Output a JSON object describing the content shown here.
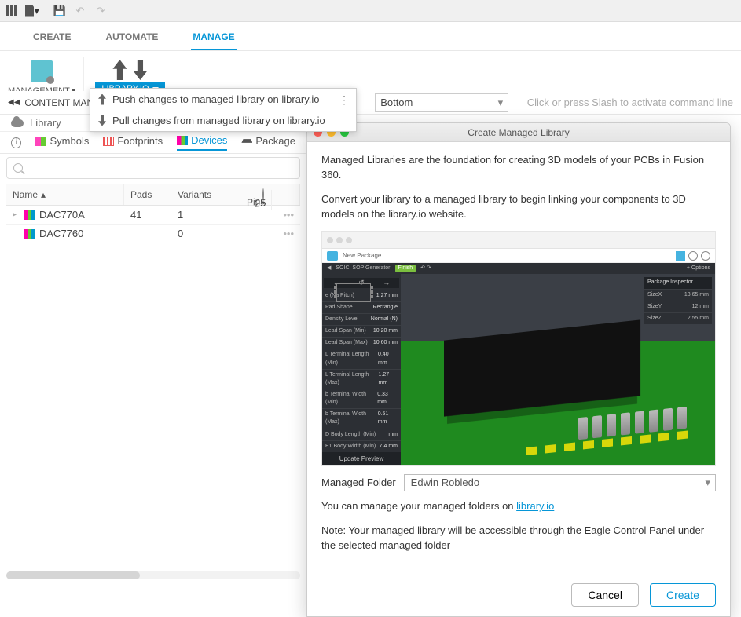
{
  "ribbon": {
    "tabs": {
      "create": "CREATE",
      "automate": "AUTOMATE",
      "manage": "MANAGE"
    },
    "management_label": "MANAGEMENT",
    "libraryio_label": "LIBRARY.IO"
  },
  "libio_menu": {
    "push": "Push changes to managed library on library.io",
    "pull": "Pull changes from managed library on library.io"
  },
  "secbar": {
    "content_manager": "CONTENT MANA",
    "layer_value": "Bottom",
    "command_placeholder": "Click or press Slash to activate command line"
  },
  "library_label": "Library",
  "subtabs": {
    "symbols": "Symbols",
    "footprints": "Footprints",
    "devices": "Devices",
    "packages": "Package"
  },
  "table": {
    "headers": {
      "name": "Name",
      "pins": "Pins",
      "pads": "Pads",
      "variants": "Variants"
    },
    "rows": [
      {
        "name": "DAC770A",
        "pins": "25",
        "pads": "41",
        "variants": "1"
      },
      {
        "name": "DAC7760",
        "pins": "",
        "pads": "",
        "variants": "0"
      }
    ]
  },
  "dialog": {
    "title": "Create Managed Library",
    "p1": "Managed Libraries are the foundation for creating 3D models of your PCBs in Fusion 360.",
    "p2": "Convert your library to a managed library to begin linking your components to 3D models on the library.io website.",
    "preview": {
      "new_package": "New Package",
      "finish": "Finish",
      "soic": "SOIC, SOP Generator",
      "options": "+ Options",
      "inspector_title": "Package Inspector",
      "inspector_rows": [
        {
          "k": "SizeX",
          "v": "13.65",
          "u": "mm"
        },
        {
          "k": "SizeY",
          "v": "12",
          "u": "mm"
        },
        {
          "k": "SizeZ",
          "v": "2.55",
          "u": "mm"
        }
      ],
      "side_rows": [
        {
          "k": "e (Na Pitch)",
          "v": "1.27",
          "u": "mm"
        },
        {
          "k": "Pad Shape",
          "v": "Rectangle",
          "u": ""
        },
        {
          "k": "Density Level",
          "v": "Normal (N)",
          "u": ""
        },
        {
          "k": "Lead Span (Min)",
          "v": "10.20",
          "u": "mm"
        },
        {
          "k": "Lead Span (Max)",
          "v": "10.60",
          "u": "mm"
        },
        {
          "k": "L Terminal Length (Min)",
          "v": "0.40",
          "u": "mm"
        },
        {
          "k": "L Terminal Length (Max)",
          "v": "1.27",
          "u": "mm"
        },
        {
          "k": "b Terminal Width (Min)",
          "v": "0.33",
          "u": "mm"
        },
        {
          "k": "b Terminal Width (Max)",
          "v": "0.51",
          "u": "mm"
        },
        {
          "k": "D Body Length (Min)",
          "v": "",
          "u": "mm"
        },
        {
          "k": "E1 Body Width (Min)",
          "v": "7.4",
          "u": "mm"
        }
      ],
      "update_preview": "Update Preview"
    },
    "managed_folder_label": "Managed Folder",
    "managed_folder_value": "Edwin Robledo",
    "manage_text_a": "You can manage your managed folders on ",
    "manage_link": "library.io",
    "note": "Note: Your managed library will be accessible through the Eagle Control Panel under the selected managed folder",
    "cancel": "Cancel",
    "create": "Create"
  }
}
